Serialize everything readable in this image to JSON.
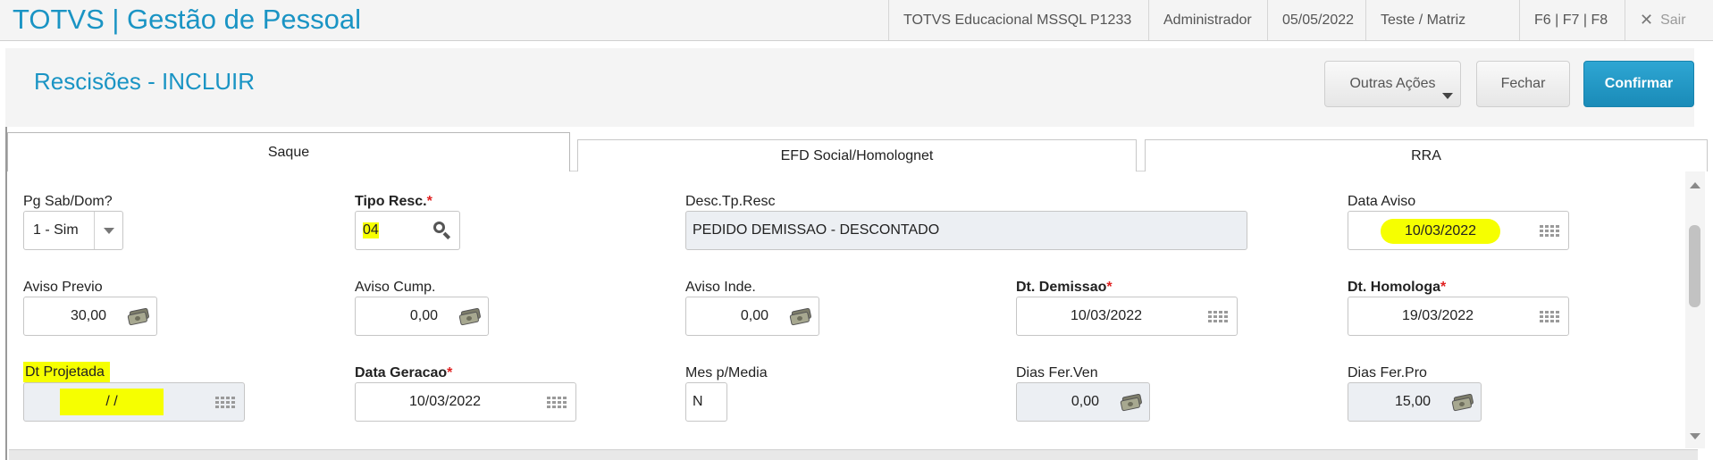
{
  "header": {
    "app_title": "TOTVS | Gestão de Pessoal",
    "environment": "TOTVS Educacional MSSQL P1233",
    "user": "Administrador",
    "date": "05/05/2022",
    "branch": "Teste / Matriz",
    "shortcuts": "F6 | F7 | F8",
    "exit_label": "Sair"
  },
  "page": {
    "title": "Rescisões - INCLUIR",
    "buttons": {
      "other_actions": "Outras Ações",
      "close": "Fechar",
      "confirm": "Confirmar"
    }
  },
  "tabs": [
    {
      "label": "Saque",
      "active": true
    },
    {
      "label": "EFD Social/Homolognet",
      "active": false
    },
    {
      "label": "RRA",
      "active": false
    }
  ],
  "form": {
    "pg_sab_dom": {
      "label": "Pg Sab/Dom?",
      "value": "1 - Sim"
    },
    "tipo_resc": {
      "label": "Tipo Resc.",
      "required": "*",
      "value": "04"
    },
    "desc_tp_resc": {
      "label": "Desc.Tp.Resc",
      "value": "PEDIDO DEMISSAO - DESCONTADO"
    },
    "data_aviso": {
      "label": "Data Aviso",
      "value": "10/03/2022"
    },
    "aviso_previo": {
      "label": "Aviso Previo",
      "value": "30,00"
    },
    "aviso_cump": {
      "label": "Aviso Cump.",
      "value": "0,00"
    },
    "aviso_inde": {
      "label": "Aviso Inde.",
      "value": "0,00"
    },
    "dt_demissao": {
      "label": "Dt. Demissao",
      "required": "*",
      "value": "10/03/2022"
    },
    "dt_homologa": {
      "label": "Dt. Homologa",
      "required": "*",
      "value": "19/03/2022"
    },
    "dt_projetada": {
      "label": "Dt Projetada",
      "value": "/  /"
    },
    "data_geracao": {
      "label": "Data Geracao",
      "required": "*",
      "value": "10/03/2022"
    },
    "mes_p_media": {
      "label": "Mes p/Media",
      "value": "N"
    },
    "dias_fer_ven": {
      "label": "Dias Fer.Ven",
      "value": "0,00"
    },
    "dias_fer_pro": {
      "label": "Dias Fer.Pro",
      "value": "15,00"
    }
  },
  "colors": {
    "brand": "#1a94c4",
    "primary_button": "#1a8bb8",
    "highlight": "#f6ff00",
    "required_star": "#e02020"
  }
}
